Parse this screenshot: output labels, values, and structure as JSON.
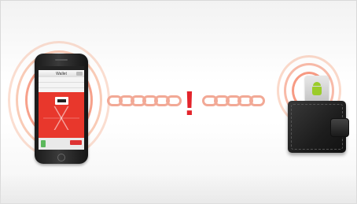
{
  "colors": {
    "accent_red": "#e3242b",
    "chain_salmon": "#f2a996",
    "wave_orange": "#f4a07a",
    "android_green": "#9bcc2a"
  },
  "phone": {
    "screen_title": "Wallet",
    "list_items": [
      "",
      "",
      ""
    ]
  },
  "alert": {
    "symbol": "!"
  },
  "icons": [
    "signal-waves-icon",
    "chain-icon",
    "exclamation-icon",
    "android-icon",
    "wallet-icon"
  ]
}
